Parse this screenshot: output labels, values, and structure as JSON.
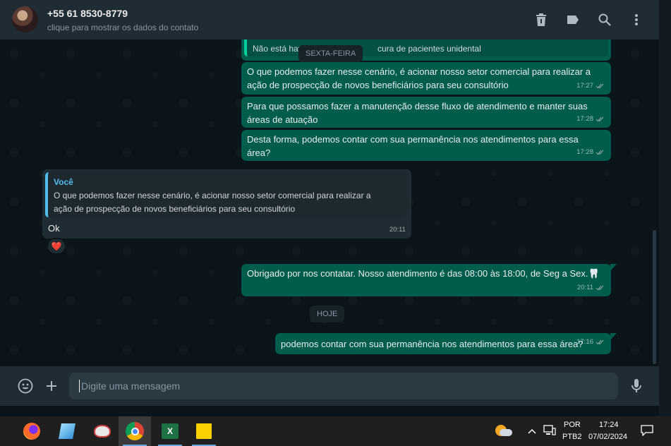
{
  "header": {
    "contact_name": "+55 61 8530-8779",
    "contact_subtitle": "clique para mostrar os dados do contato"
  },
  "messages": {
    "m0_quote": "Não está hav",
    "m0_quote_tail": "cura de pacientes unidental",
    "chip_friday": "SEXTA-FEIRA",
    "m1_text": "O que podemos fazer nesse cenário, é acionar nosso setor comercial para realizar a ação de prospecção de novos beneficiários para seu consultório",
    "m1_time": "17:27",
    "m2_text": "Para que possamos fazer a manutenção desse fluxo de atendimento e manter suas áreas de atuação",
    "m2_time": "17:28",
    "m3_text": "Desta forma, podemos contar com sua permanência nos atendimentos para essa área?",
    "m3_time": "17:28",
    "m4_quote_author": "Você",
    "m4_quote_text": "O que podemos fazer nesse cenário, é acionar nosso setor comercial para realizar a ação de prospecção de novos beneficiários para seu consultório",
    "m4_text": "Ok",
    "m4_time": "20:11",
    "m4_reaction": "❤️",
    "m5_text": "Obrigado por nos contatar. Nosso atendimento é das 08:00 às 18:00, de Seg a Sex.🦷",
    "m5_time": "20:11",
    "chip_today": "HOJE",
    "m6_text": "podemos contar com sua permanência nos atendimentos para essa área?",
    "m6_time": "17:16"
  },
  "footer": {
    "input_placeholder": "Digite uma mensagem"
  },
  "taskbar": {
    "lang_top": "POR",
    "lang_bottom": "PTB2",
    "clock_time": "17:24",
    "clock_date": "07/02/2024"
  },
  "colors": {
    "outgoing_bubble": "#005c4b",
    "incoming_bubble": "#202c33",
    "header_bg": "#202c33",
    "quote_accent": "#53bdeb"
  }
}
